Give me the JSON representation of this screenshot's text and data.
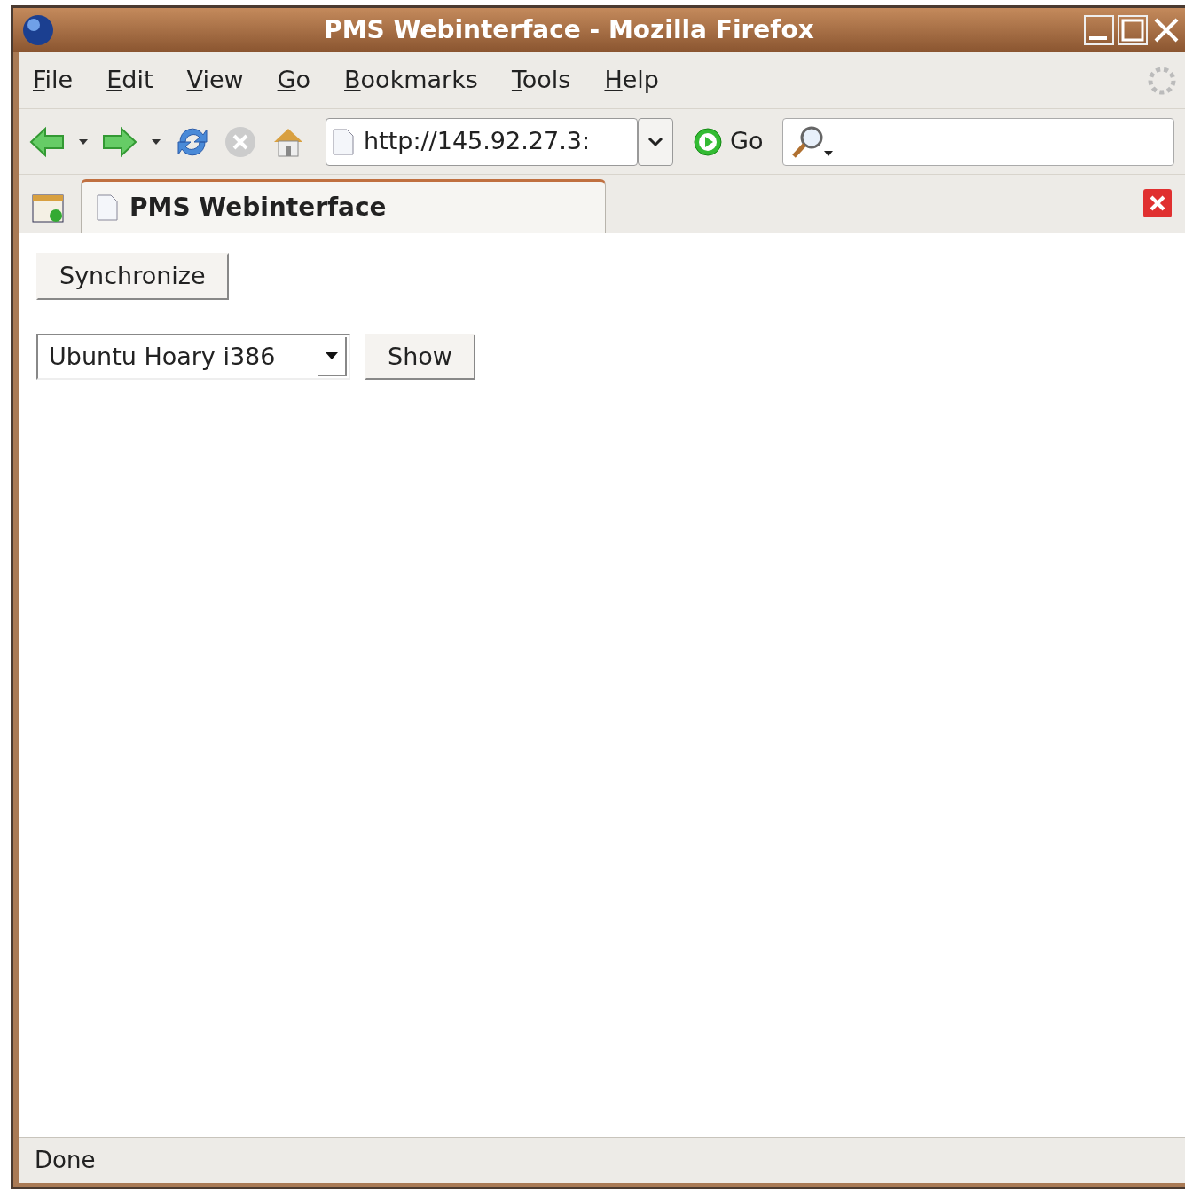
{
  "window": {
    "title": "PMS Webinterface - Mozilla Firefox"
  },
  "menu": [
    {
      "label": "File"
    },
    {
      "label": "Edit"
    },
    {
      "label": "View"
    },
    {
      "label": "Go"
    },
    {
      "label": "Bookmarks"
    },
    {
      "label": "Tools"
    },
    {
      "label": "Help"
    }
  ],
  "toolbar": {
    "address": "http://145.92.27.3:",
    "go": "Go"
  },
  "tabs": [
    {
      "label": "PMS Webinterface",
      "selected": true
    }
  ],
  "page": {
    "sync_button": "Synchronize",
    "select_value": "Ubuntu Hoary i386",
    "show_button": "Show"
  },
  "status_bar": "Done"
}
